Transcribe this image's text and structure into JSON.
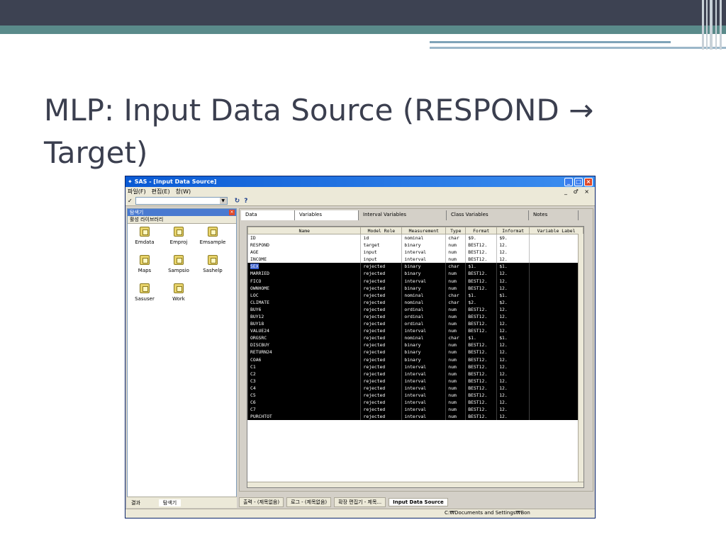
{
  "slide": {
    "title": "MLP: Input Data Source (RESPOND → Target)",
    "colors": {
      "top_bar": "#3d4252",
      "band": "#5a8a8a",
      "title": "#3b3f4f"
    }
  },
  "window": {
    "title": "SAS - [Input Data Source]",
    "menu": [
      "파일(F)",
      "편집(E)",
      "창(W)"
    ],
    "mdi_controls": "_ ♂ ×",
    "toolbar_check": "✓",
    "toolbar_icons": [
      "↻",
      "?"
    ]
  },
  "explorer": {
    "header": "탐색기",
    "subheader": "활성 라이브러리",
    "libraries": [
      "Emdata",
      "Emproj",
      "Emsample",
      "Maps",
      "Sampsio",
      "Sashelp",
      "Sasuser",
      "Work"
    ],
    "bottom_tabs": [
      "결과",
      "탐색기"
    ]
  },
  "tabs": [
    "Data",
    "Variables",
    "Interval Variables",
    "Class Variables",
    "Notes"
  ],
  "table": {
    "columns": [
      "Name",
      "Model Role",
      "Measurement",
      "Type",
      "Format",
      "Informat",
      "Variable Label"
    ],
    "rows": [
      [
        "ID",
        "id",
        "nominal",
        "char",
        "$9.",
        "$9.",
        ""
      ],
      [
        "RESPOND",
        "target",
        "binary",
        "num",
        "BEST12.",
        "12.",
        ""
      ],
      [
        "AGE",
        "input",
        "interval",
        "num",
        "BEST12.",
        "12.",
        ""
      ],
      [
        "INCOME",
        "input",
        "interval",
        "num",
        "BEST12.",
        "12.",
        ""
      ],
      [
        "SEX",
        "rejected",
        "binary",
        "char",
        "$1.",
        "$1.",
        ""
      ],
      [
        "MARRIED",
        "rejected",
        "binary",
        "num",
        "BEST12.",
        "12.",
        ""
      ],
      [
        "FICO",
        "rejected",
        "interval",
        "num",
        "BEST12.",
        "12.",
        ""
      ],
      [
        "OWNHOME",
        "rejected",
        "binary",
        "num",
        "BEST12.",
        "12.",
        ""
      ],
      [
        "LOC",
        "rejected",
        "nominal",
        "char",
        "$1.",
        "$1.",
        ""
      ],
      [
        "CLIMATE",
        "rejected",
        "nominal",
        "char",
        "$2.",
        "$2.",
        ""
      ],
      [
        "BUY6",
        "rejected",
        "ordinal",
        "num",
        "BEST12.",
        "12.",
        ""
      ],
      [
        "BUY12",
        "rejected",
        "ordinal",
        "num",
        "BEST12.",
        "12.",
        ""
      ],
      [
        "BUY18",
        "rejected",
        "ordinal",
        "num",
        "BEST12.",
        "12.",
        ""
      ],
      [
        "VALUE24",
        "rejected",
        "interval",
        "num",
        "BEST12.",
        "12.",
        ""
      ],
      [
        "ORGSRC",
        "rejected",
        "nominal",
        "char",
        "$1.",
        "$1.",
        ""
      ],
      [
        "DISCBUY",
        "rejected",
        "binary",
        "num",
        "BEST12.",
        "12.",
        ""
      ],
      [
        "RETURN24",
        "rejected",
        "binary",
        "num",
        "BEST12.",
        "12.",
        ""
      ],
      [
        "COA6",
        "rejected",
        "binary",
        "num",
        "BEST12.",
        "12.",
        ""
      ],
      [
        "C1",
        "rejected",
        "interval",
        "num",
        "BEST12.",
        "12.",
        ""
      ],
      [
        "C2",
        "rejected",
        "interval",
        "num",
        "BEST12.",
        "12.",
        ""
      ],
      [
        "C3",
        "rejected",
        "interval",
        "num",
        "BEST12.",
        "12.",
        ""
      ],
      [
        "C4",
        "rejected",
        "interval",
        "num",
        "BEST12.",
        "12.",
        ""
      ],
      [
        "C5",
        "rejected",
        "interval",
        "num",
        "BEST12.",
        "12.",
        ""
      ],
      [
        "C6",
        "rejected",
        "interval",
        "num",
        "BEST12.",
        "12.",
        ""
      ],
      [
        "C7",
        "rejected",
        "interval",
        "num",
        "BEST12.",
        "12.",
        ""
      ],
      [
        "PURCHTOT",
        "rejected",
        "interval",
        "num",
        "BEST12.",
        "12.",
        ""
      ]
    ]
  },
  "taskbar": [
    "출력 - (제목없음)",
    "로그 - (제목없음)",
    "확장 편집기 - 제목...",
    "Input Data Source"
  ],
  "status_path": "C:₩Documents and Settings₩Bon"
}
